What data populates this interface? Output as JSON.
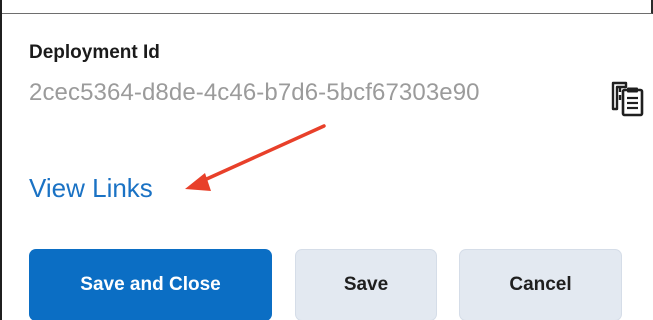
{
  "deployment": {
    "label": "Deployment Id",
    "value": "2cec5364-d8de-4c46-b7d6-5bcf67303e90",
    "copy_icon": "copy-clipboard-icon"
  },
  "links": {
    "view_links_label": "View Links"
  },
  "annotation": {
    "arrow_color": "#e8402a"
  },
  "actions": {
    "save_and_close_label": "Save and Close",
    "save_label": "Save",
    "cancel_label": "Cancel"
  },
  "colors": {
    "primary": "#0b6ec4",
    "link": "#1a72c4",
    "secondary_bg": "#e3e9f1",
    "muted_text": "#9b9b9b"
  }
}
